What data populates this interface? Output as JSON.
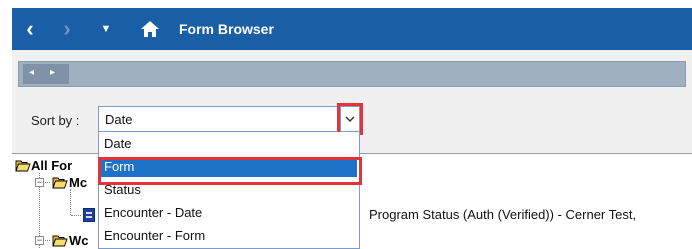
{
  "app": {
    "title": "Form Browser",
    "back_glyph": "‹",
    "forward_glyph": "›",
    "menu_glyph": "▼",
    "home_icon": "home-icon"
  },
  "nav": {
    "left_glyph": "◂",
    "right_glyph": "▸"
  },
  "sort": {
    "label": "Sort by :",
    "value": "Date",
    "options": [
      "Date",
      "Form",
      "Status",
      "Encounter - Date",
      "Encounter - Form"
    ],
    "selected_index": 1
  },
  "tree": {
    "root_label": "All For",
    "child1_label": "Mc",
    "child2_label": "Wc",
    "row_text": "Program Status (Auth (Verified)) - Cerner Test,"
  },
  "colors": {
    "titlebar": "#1a5ea6",
    "highlight": "#e53238",
    "selection": "#1e73c8"
  }
}
